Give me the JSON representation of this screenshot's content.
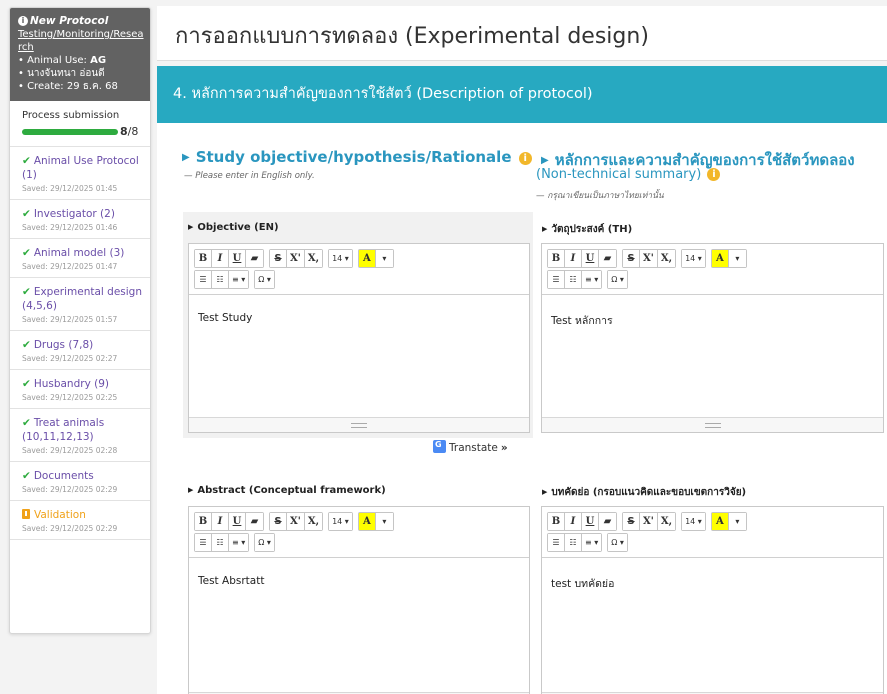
{
  "sidebar": {
    "protocol_title": "New Protocol",
    "protocol_link": "Testing/Monitoring/Research",
    "animal_use_label": "• Animal Use: ",
    "animal_use_value": "AG",
    "owner": "• นางจันทนา อ่อนดี",
    "create": "• Create: 29 ธ.ค. 68",
    "process_label": "Process submission",
    "process_done": "8",
    "process_total": "/8",
    "process_fraction": 1.0,
    "steps": [
      {
        "label": "Animal Use Protocol (1)",
        "saved": "Saved: 29/12/2025 01:45",
        "status": "done"
      },
      {
        "label": "Investigator (2)",
        "saved": "Saved: 29/12/2025 01:46",
        "status": "done"
      },
      {
        "label": "Animal model (3)",
        "saved": "Saved: 29/12/2025 01:47",
        "status": "done"
      },
      {
        "label": "Experimental design (4,5,6)",
        "saved": "Saved: 29/12/2025 01:57",
        "status": "done"
      },
      {
        "label": "Drugs (7,8)",
        "saved": "Saved: 29/12/2025 02:27",
        "status": "done"
      },
      {
        "label": "Husbandry (9)",
        "saved": "Saved: 29/12/2025 02:25",
        "status": "done"
      },
      {
        "label": "Treat animals (10,11,12,13)",
        "saved": "Saved: 29/12/2025 02:28",
        "status": "done"
      },
      {
        "label": "Documents",
        "saved": "Saved: 29/12/2025 02:29",
        "status": "done"
      },
      {
        "label": "Validation",
        "saved": "Saved: 29/12/2025 02:29",
        "status": "warning"
      }
    ]
  },
  "page": {
    "title": "การออกแบบการทดลอง (Experimental design)",
    "section_header": "4. หลักการความสำคัญของการใช้สัตว์ (Description of protocol)"
  },
  "left_column": {
    "title": "Study objective/hypothesis/Rationale",
    "hint": "— Please enter in English only.",
    "objective_label": "Objective (EN)",
    "objective_value": "Test Study",
    "translate_label": "Transtate",
    "abstract_label": "Abstract (Conceptual framework)",
    "abstract_value": "Test Absrtatt"
  },
  "right_column": {
    "title": "หลักการและความสำคัญของการใช้สัตว์ทดลอง",
    "subtitle": "(Non-technical summary)",
    "hint": "— กรุณาเขียนเป็นภาษาไทยเท่านั้น",
    "objective_label": "วัตถุประสงค์ (TH)",
    "objective_value": "Test หลักการ",
    "abstract_label": "บทคัดย่อ (กรอบแนวคิดและขอบเขตการวิจัย)",
    "abstract_value": "test บทคัดย่อ"
  },
  "toolbar": {
    "bold": "B",
    "italic": "I",
    "underline": "U",
    "eraser": "▰",
    "strike": "S",
    "superscript": "X'",
    "subscript": "X,",
    "font_size": "14 ▾",
    "highlight": "A",
    "color_caret": "▾",
    "ul": "☰",
    "ol": "☷",
    "align": "≡ ▾",
    "special": "Ω ▾"
  },
  "colors": {
    "accent": "#27a9c1",
    "link_blue": "#2a96bf",
    "step_purple": "#6a4ea8",
    "success": "#2eab3f",
    "warning": "#f0a21a"
  }
}
